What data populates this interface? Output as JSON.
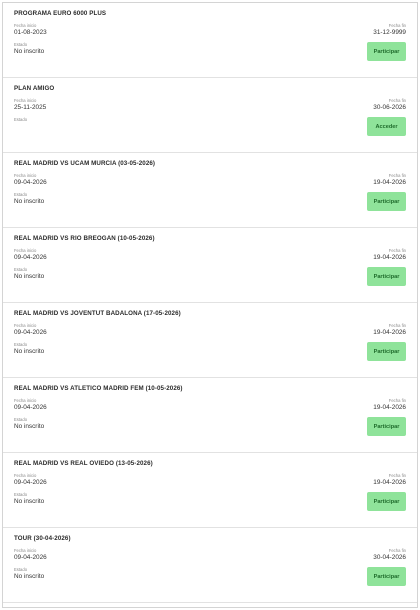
{
  "labels": {
    "start": "Fecha inicio",
    "end": "Fecha fin",
    "state": "Estado"
  },
  "programs": [
    {
      "title": "PROGRAMA EURO 6000 PLUS",
      "start_date": "01-08-2023",
      "end_date": "31-12-9999",
      "state": "No inscrito",
      "action": "Participar"
    },
    {
      "title": "PLAN AMIGO",
      "start_date": "25-11-2025",
      "end_date": "30-06-2026",
      "state": "",
      "action": "Acceder"
    },
    {
      "title": "REAL MADRID VS UCAM MURCIA (03-05-2026)",
      "start_date": "09-04-2026",
      "end_date": "19-04-2026",
      "state": "No inscrito",
      "action": "Participar"
    },
    {
      "title": "REAL MADRID VS RIO BREOGAN (10-05-2026)",
      "start_date": "09-04-2026",
      "end_date": "19-04-2026",
      "state": "No inscrito",
      "action": "Participar"
    },
    {
      "title": "REAL MADRID VS JOVENTUT BADALONA (17-05-2026)",
      "start_date": "09-04-2026",
      "end_date": "19-04-2026",
      "state": "No inscrito",
      "action": "Participar"
    },
    {
      "title": "REAL MADRID VS ATLETICO MADRID FEM (10-05-2026)",
      "start_date": "09-04-2026",
      "end_date": "19-04-2026",
      "state": "No inscrito",
      "action": "Participar"
    },
    {
      "title": "REAL MADRID VS REAL OVIEDO (13-05-2026)",
      "start_date": "09-04-2026",
      "end_date": "19-04-2026",
      "state": "No inscrito",
      "action": "Participar"
    },
    {
      "title": "TOUR (30-04-2026)",
      "start_date": "09-04-2026",
      "end_date": "30-04-2026",
      "state": "No inscrito",
      "action": "Participar"
    }
  ]
}
